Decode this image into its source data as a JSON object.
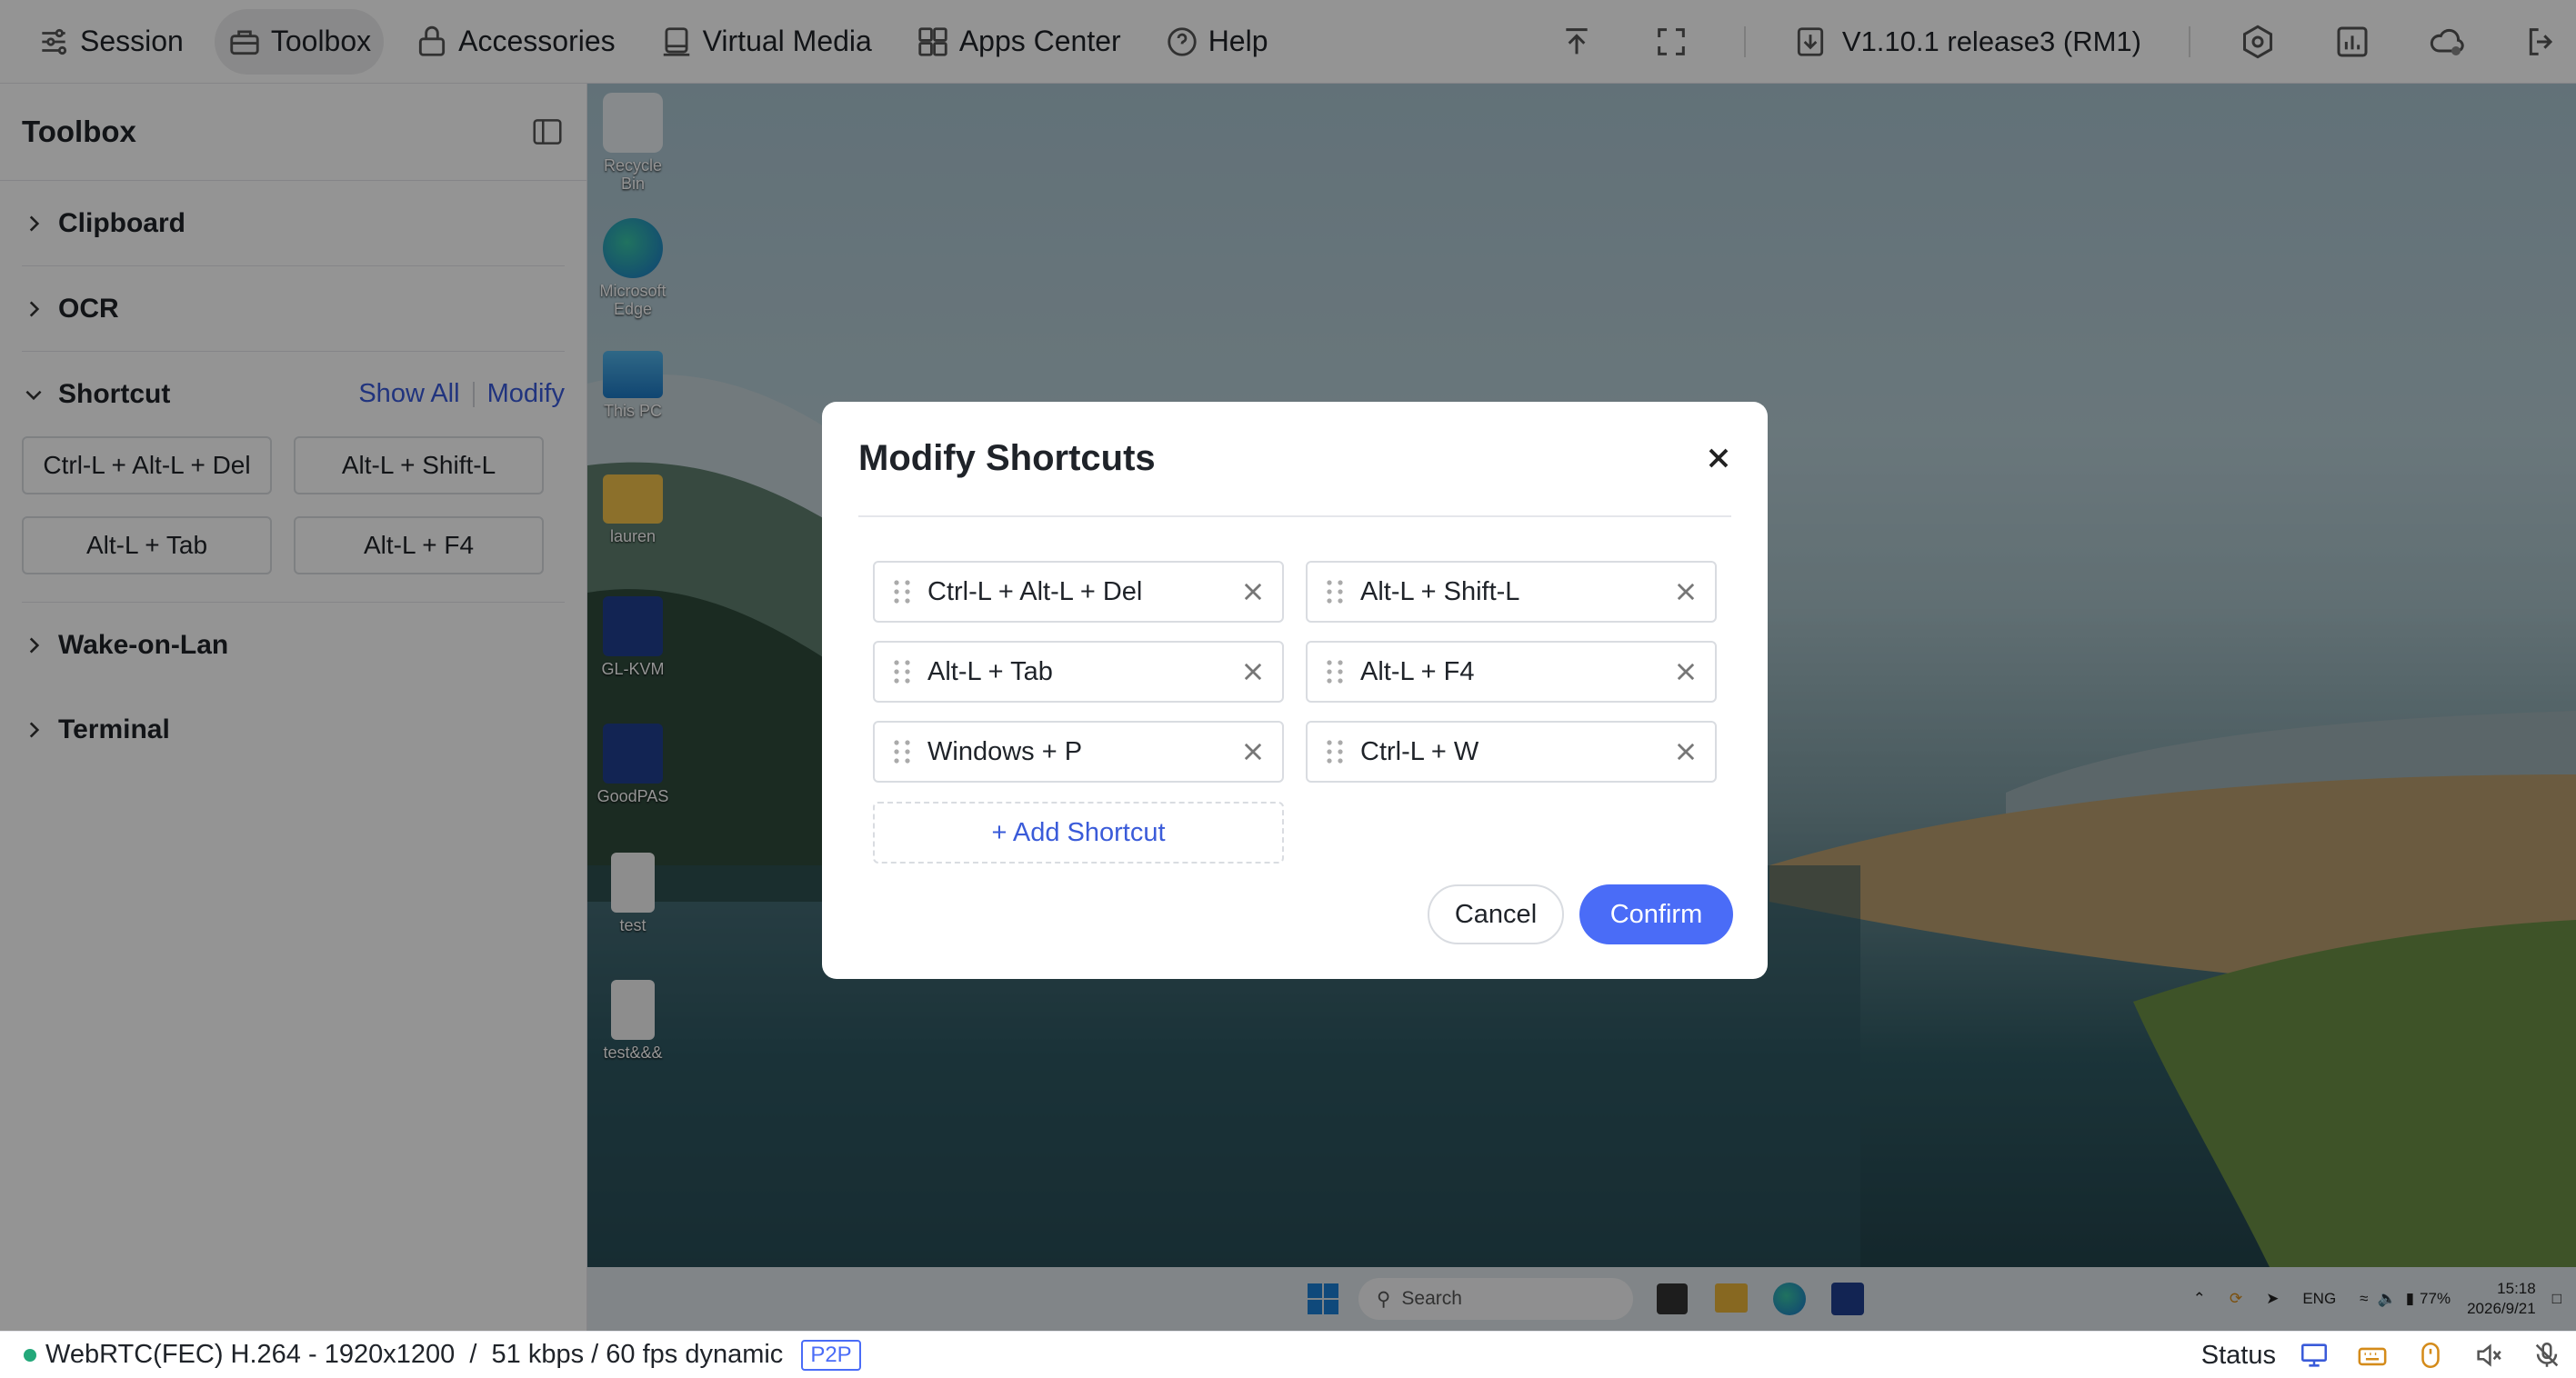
{
  "nav": {
    "items": [
      {
        "label": "Session",
        "icon": "sliders-icon"
      },
      {
        "label": "Toolbox",
        "icon": "toolbox-icon",
        "active": true
      },
      {
        "label": "Accessories",
        "icon": "lock-icon"
      },
      {
        "label": "Virtual Media",
        "icon": "drive-icon"
      },
      {
        "label": "Apps Center",
        "icon": "grid-icon"
      },
      {
        "label": "Help",
        "icon": "help-icon"
      }
    ],
    "version": "V1.10.1 release3 (RM1)"
  },
  "sidebar": {
    "title": "Toolbox",
    "sections": {
      "clipboard": "Clipboard",
      "ocr": "OCR",
      "shortcut": "Shortcut",
      "wake_on_lan": "Wake-on-Lan",
      "terminal": "Terminal"
    },
    "shortcut_show_all": "Show All",
    "shortcut_modify": "Modify",
    "shortcuts": [
      "Ctrl-L + Alt-L + Del",
      "Alt-L + Shift-L",
      "Alt-L + Tab",
      "Alt-L + F4"
    ]
  },
  "desktop": {
    "icons": [
      "Recycle Bin",
      "Microsoft Edge",
      "This PC",
      "lauren",
      "GL-KVM",
      "GoodPAS",
      "test",
      "test&&&"
    ],
    "taskbar": {
      "search_placeholder": "Search",
      "language": "ENG",
      "battery": "77%",
      "time": "15:18",
      "date": "2026/9/21"
    }
  },
  "dialog": {
    "title": "Modify Shortcuts",
    "shortcuts": [
      "Ctrl-L + Alt-L + Del",
      "Alt-L + Shift-L",
      "Alt-L + Tab",
      "Alt-L + F4",
      "Windows + P",
      "Ctrl-L + W"
    ],
    "add_label": "+ Add Shortcut",
    "cancel_label": "Cancel",
    "confirm_label": "Confirm"
  },
  "status": {
    "connection": "WebRTC(FEC) H.264 - 1920x1200  /  51 kbps / 60 fps dynamic",
    "mode": "P2P",
    "status_label": "Status"
  },
  "colors": {
    "accent": "#4a6cf7",
    "link": "#3a5bd9",
    "connection_ok": "#23a87a"
  }
}
